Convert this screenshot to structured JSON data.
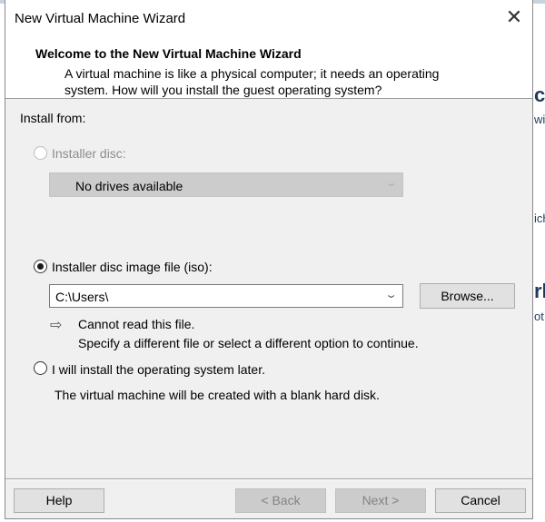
{
  "background_fragments": [
    "c",
    "wi",
    "ich",
    "rk",
    "ot"
  ],
  "window": {
    "title": "New Virtual Machine Wizard",
    "close_icon": "close-icon"
  },
  "header": {
    "title": "Welcome to the New Virtual Machine Wizard",
    "description": "A virtual machine is like a physical computer; it needs an operating system. How will you install the guest operating system?"
  },
  "install_from": {
    "label": "Install from:",
    "installer_disc": {
      "label": "Installer disc:",
      "selected": false,
      "enabled": false,
      "dropdown_value": "No drives available"
    },
    "iso": {
      "label": "Installer disc image file (iso):",
      "selected": true,
      "path_value": "C:\\Users\\",
      "browse_label": "Browse...",
      "warning_icon": "arrow-right-icon",
      "warning_line1": "Cannot read this file.",
      "warning_line2": "Specify a different file or select a different option to continue."
    },
    "later": {
      "label": "I will install the operating system later.",
      "selected": false,
      "note": "The virtual machine will be created with a blank hard disk."
    }
  },
  "footer": {
    "help": "Help",
    "back": "< Back",
    "next": "Next >",
    "cancel": "Cancel",
    "back_enabled": false,
    "next_enabled": false
  }
}
